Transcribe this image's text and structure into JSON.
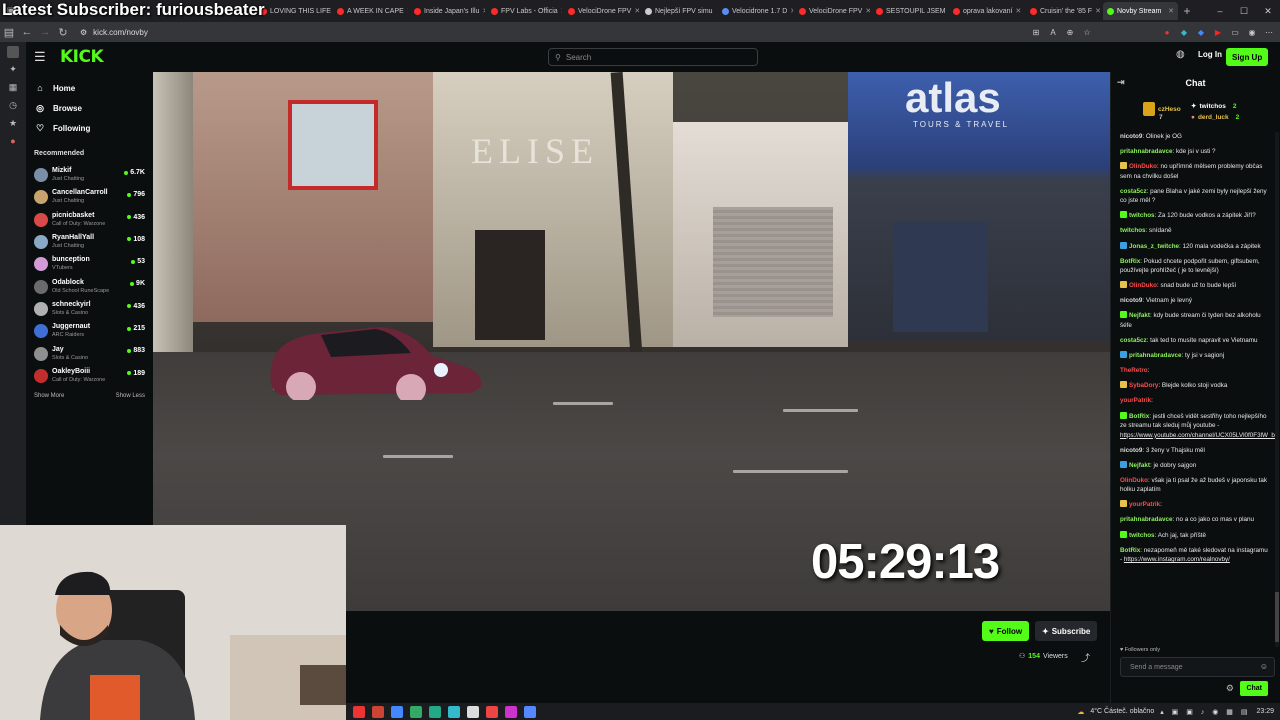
{
  "overlay": {
    "title": "Latest Subscriber: furiousbeater"
  },
  "browser": {
    "tabs": [
      {
        "label": "LOVING THIS LIFE",
        "color": "#ff2a2a"
      },
      {
        "label": "A WEEK IN CAPE",
        "color": "#ff2a2a"
      },
      {
        "label": "Inside Japan's Illu",
        "color": "#ff2a2a"
      },
      {
        "label": "FPV Labs - Officia",
        "color": "#ff2a2a"
      },
      {
        "label": "VelociDrone FPV",
        "color": "#ff2a2a"
      },
      {
        "label": "Nejlepší FPV simu",
        "color": "#cccccc"
      },
      {
        "label": "Velocidrone 1.7 D",
        "color": "#5b8def"
      },
      {
        "label": "VelociDrone FPV",
        "color": "#ff2a2a"
      },
      {
        "label": "SESTOUPIL JSEM",
        "color": "#ff2a2a"
      },
      {
        "label": "oprava lakovaní",
        "color": "#ff2a2a"
      },
      {
        "label": "Cruisin' the '85 F",
        "color": "#ff2a2a"
      },
      {
        "label": "Novby Stream",
        "color": "#53fc18",
        "active": true
      }
    ],
    "url": "kick.com/novby",
    "window_controls": [
      "–",
      "☐",
      "✕"
    ]
  },
  "header": {
    "logo": "KICK",
    "search_placeholder": "Search",
    "login": "Log In",
    "signup": "Sign Up"
  },
  "sidebar": {
    "nav": [
      {
        "label": "Home",
        "icon": "home-icon"
      },
      {
        "label": "Browse",
        "icon": "compass-icon"
      },
      {
        "label": "Following",
        "icon": "heart-icon"
      }
    ],
    "recommended_title": "Recommended",
    "channels": [
      {
        "name": "Mizkif",
        "category": "Just Chatting",
        "viewers": "6.7K",
        "color": "#7a8ea8"
      },
      {
        "name": "CancellanCarroll",
        "category": "Just Chatting",
        "viewers": "796",
        "color": "#c9a36e"
      },
      {
        "name": "picnicbasket",
        "category": "Call of Duty: Warzone",
        "viewers": "436",
        "color": "#d84a4a"
      },
      {
        "name": "RyanHallYall",
        "category": "Just Chatting",
        "viewers": "108",
        "color": "#8aa9c7"
      },
      {
        "name": "bunception",
        "category": "VTubers",
        "viewers": "53",
        "color": "#d49ad6"
      },
      {
        "name": "Odablock",
        "category": "Old School RuneScape",
        "viewers": "9K",
        "color": "#6b6b6b"
      },
      {
        "name": "schneckyirl",
        "category": "Slots & Casino",
        "viewers": "436",
        "color": "#b0b0b0"
      },
      {
        "name": "Juggernaut",
        "category": "ARC Raiders",
        "viewers": "215",
        "color": "#3f6fd6"
      },
      {
        "name": "Jay",
        "category": "Slots & Casino",
        "viewers": "883",
        "color": "#8f8f8f"
      },
      {
        "name": "OakleyBoiii",
        "category": "Call of Duty: Warzone",
        "viewers": "189",
        "color": "#c22e2e"
      }
    ],
    "show_more": "Show More",
    "show_less": "Show Less"
  },
  "video": {
    "sign_elise": "ELISE",
    "sign_atlas": "atlas",
    "sign_atlas_sub": "TOURS & TRAVEL",
    "timer": "05:29:13"
  },
  "below_video": {
    "follow": "Follow",
    "subscribe": "Subscribe",
    "viewers_count": "154",
    "viewers_label": "Viewers"
  },
  "chat": {
    "title": "Chat",
    "pinned": [
      {
        "name": "czHeso",
        "count": "7"
      },
      {
        "name": "twitchos",
        "count": "2"
      },
      {
        "name": "derd_luck",
        "count": "2"
      }
    ],
    "messages": [
      {
        "user": "nicoto9",
        "color": "#dcdcdc",
        "text": "Olinek je OG"
      },
      {
        "user": "pritahnabradavce",
        "color": "#8ef05e",
        "text": "kde jsi v usti ?"
      },
      {
        "user": "OlinDuko",
        "color": "#ff4a4a",
        "text": "no upřímně mělsem problemy občas sem na chvilku došel"
      },
      {
        "user": "costa5cz",
        "color": "#8ef05e",
        "text": "pane Blaha v jaké zemi byly nejlepší ženy co jste měl ?"
      },
      {
        "user": "twitchos",
        "color": "#8ef05e",
        "text": "Za 120 bude vodkos a zápitek Jiří?"
      },
      {
        "user": "twitchos",
        "color": "#8ef05e",
        "text": "snídaně"
      },
      {
        "user": "Jonas_z_twitche",
        "color": "#8ef05e",
        "text": "120 mala vodečka a zápitek"
      },
      {
        "user": "BotRix",
        "color": "#8ef05e",
        "text": "Pokud chcete podpořit subem, giftsubem, používejte prohlížeč ( je to levnější)"
      },
      {
        "user": "OlinDuko",
        "color": "#ff4a4a",
        "text": "snad bude už to bude lepší"
      },
      {
        "user": "nicoto9",
        "color": "#dcdcdc",
        "text": "Vietnam je levný"
      },
      {
        "user": "Nejfakt",
        "color": "#8ef05e",
        "text": "kdy bude stream či tyden bez alkoholu šéfe"
      },
      {
        "user": "costa5cz",
        "color": "#8ef05e",
        "text": "tak ted to musíte napravit ve Vietnamu"
      },
      {
        "user": "pritahnabradavce",
        "color": "#8ef05e",
        "text": "ty jsi v sagionj"
      },
      {
        "user": "TheRetro",
        "color": "#ff4a4a",
        "text": ""
      },
      {
        "user": "SybaDory",
        "color": "#ff4a4a",
        "text": "Blejde kolko stoji vodka"
      },
      {
        "user": "yourPatrik",
        "color": "#ff4a4a",
        "text": ""
      },
      {
        "user": "BotRix",
        "color": "#8ef05e",
        "text": "jestli chceš vidět sestřihy toho nejlepšího ze streamu tak sleduj můj youtube - ",
        "link": "https://www.youtube.com/channel/UCX05LVl0f0F3lW_bT3RSiMw"
      },
      {
        "user": "nicoto9",
        "color": "#dcdcdc",
        "text": "3 ženy v Thajsku měl"
      },
      {
        "user": "Nejfakt",
        "color": "#8ef05e",
        "text": "je dobry sajgon"
      },
      {
        "user": "OlinDuko",
        "color": "#ff4a4a",
        "text": "však ja ti psal že až budeš v japonsku tak holku zaplatím"
      },
      {
        "user": "yourPatrik",
        "color": "#ff4a4a",
        "text": ""
      },
      {
        "user": "pritahnabradavce",
        "color": "#8ef05e",
        "text": "no a co jako co mas v planu"
      },
      {
        "user": "twitchos",
        "color": "#8ef05e",
        "text": "Ach jaj, tak příště"
      },
      {
        "user": "BotRix",
        "color": "#8ef05e",
        "text": "nezapomeň mě také sledovat na instagramu - ",
        "link": "https://www.instagram.com/realnovby/"
      }
    ],
    "followers_only": "Followers only",
    "send_placeholder": "Send a message",
    "chat_button": "Chat"
  },
  "taskbar": {
    "weather": "4°C  Částeč. oblačno",
    "time": "23:29"
  }
}
